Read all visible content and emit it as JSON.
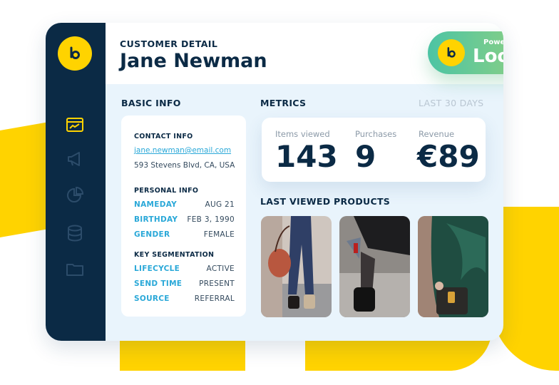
{
  "header": {
    "subtitle": "CUSTOMER DETAIL",
    "customer_name": "Jane Newman",
    "badge_powered": "Powered by",
    "badge_brand": "Loomi"
  },
  "sidebar": {
    "items": [
      {
        "icon": "dashboard-icon",
        "active": true
      },
      {
        "icon": "megaphone-icon",
        "active": false
      },
      {
        "icon": "pie-chart-icon",
        "active": false
      },
      {
        "icon": "database-icon",
        "active": false
      },
      {
        "icon": "folder-icon",
        "active": false
      }
    ]
  },
  "basic_info": {
    "title": "BASIC INFO",
    "contact_heading": "CONTACT INFO",
    "email": "jane.newman@email.com",
    "address": "593 Stevens Blvd, CA, USA",
    "personal_heading": "PERSONAL INFO",
    "personal": [
      {
        "key": "NAMEDAY",
        "value": "AUG 21"
      },
      {
        "key": "BIRTHDAY",
        "value": "FEB 3, 1990"
      },
      {
        "key": "GENDER",
        "value": "FEMALE"
      }
    ],
    "segmentation_heading": "KEY SEGMENTATION",
    "segmentation": [
      {
        "key": "LIFECYCLE",
        "value": "ACTIVE"
      },
      {
        "key": "SEND TIME",
        "value": "PRESENT"
      },
      {
        "key": "SOURCE",
        "value": "REFERRAL"
      }
    ]
  },
  "metrics": {
    "title": "METRICS",
    "period": "LAST 30 DAYS",
    "items": [
      {
        "label": "Items viewed",
        "value": "143"
      },
      {
        "label": "Purchases",
        "value": "9"
      },
      {
        "label": "Revenue",
        "value": "€89"
      }
    ]
  },
  "products": {
    "title": "LAST VIEWED PRODUCTS"
  },
  "colors": {
    "navy": "#0b2a45",
    "yellow": "#ffd300",
    "accent_blue": "#2aa8d8",
    "loomi_green_start": "#4cc4a4",
    "loomi_green_end": "#9ed37a",
    "panel_bg": "#e9f4fc"
  }
}
